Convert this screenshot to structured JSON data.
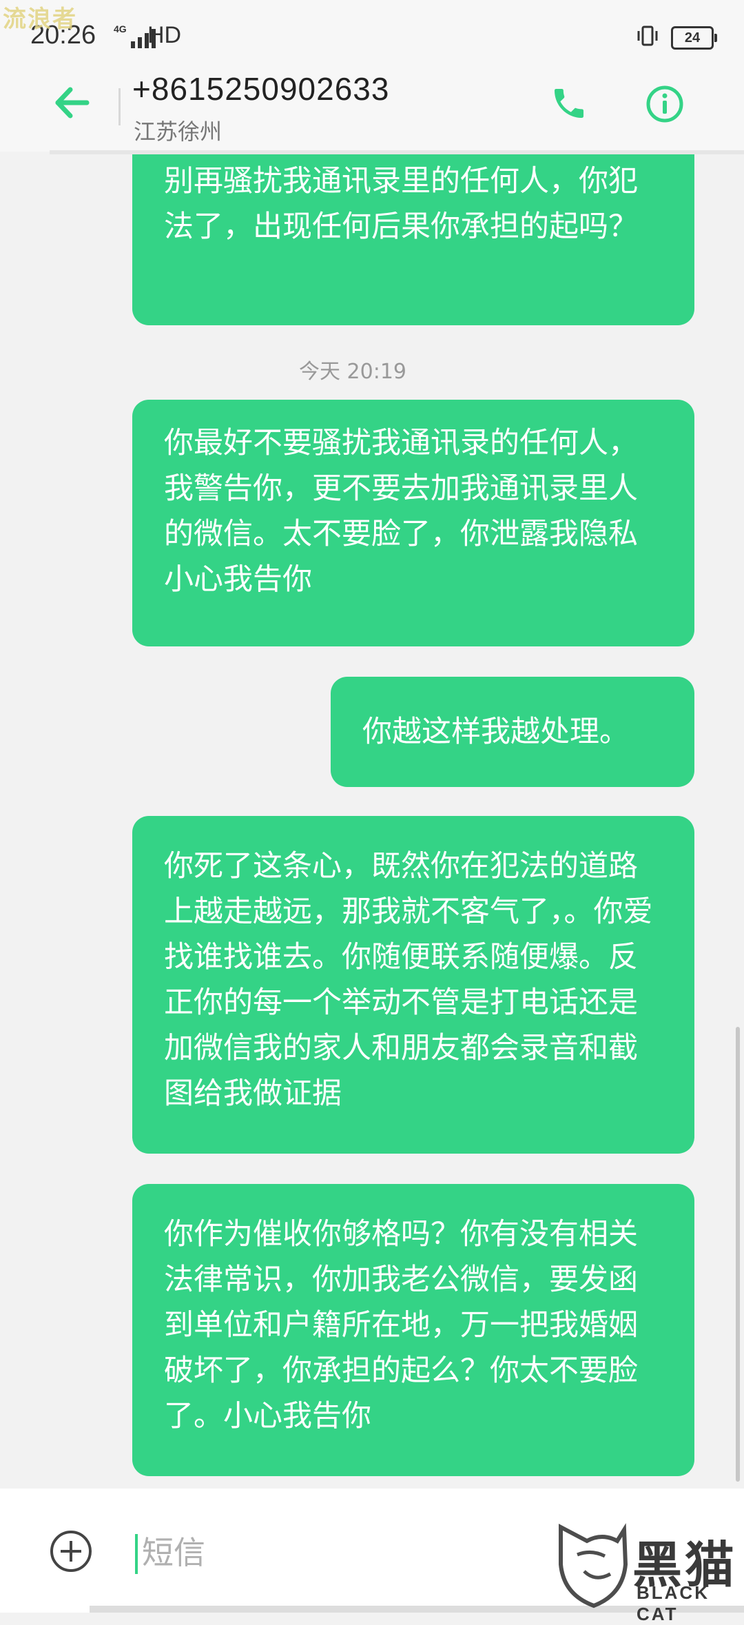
{
  "watermark_top": "流浪者",
  "status_bar": {
    "time": "20:26",
    "network": "4G",
    "hd": "HD",
    "battery": "24"
  },
  "header": {
    "phone_number": "+8615250902633",
    "location": "江苏徐州"
  },
  "messages": [
    {
      "text": "别再骚扰我通讯录里的任何人，你犯法了，出现任何后果你承担的起吗？"
    },
    {
      "timestamp": "今天 20:19"
    },
    {
      "text": "你最好不要骚扰我通讯录的任何人，我警告你，更不要去加我通讯录里人的微信。太不要脸了，你泄露我隐私小心我告你"
    },
    {
      "text": "你越这样我越处理。"
    },
    {
      "text": "你死了这条心，既然你在犯法的道路上越走越远，那我就不客气了，。你爱找谁找谁去。你随便联系随便爆。反正你的每一个举动不管是打电话还是加微信我的家人和朋友都会录音和截图给我做证据"
    },
    {
      "text": "你作为催收你够格吗？你有没有相关法律常识，你加我老公微信，要发函到单位和户籍所在地，万一把我婚姻破坏了，你承担的起么？你太不要脸了。小心我告你"
    }
  ],
  "composer": {
    "placeholder": "短信"
  },
  "brand": {
    "cn": "黑猫",
    "en": "BLACK CAT"
  },
  "colors": {
    "bubble": "#34d386",
    "accent": "#34d386",
    "background": "#f2f2f2"
  }
}
